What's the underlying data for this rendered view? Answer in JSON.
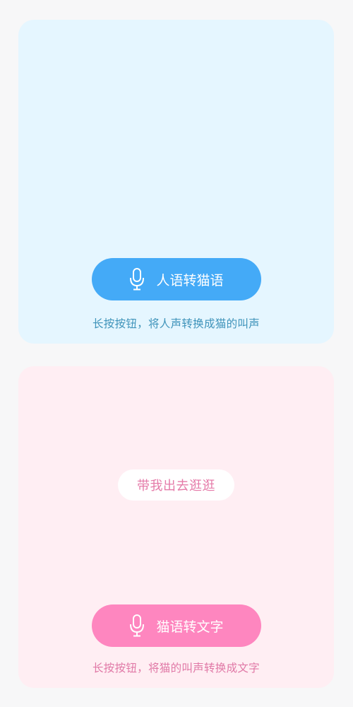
{
  "human_to_cat": {
    "button_label": "人语转猫语",
    "hint": "长按按钮，将人声转换成猫的叫声",
    "icon": "microphone-icon",
    "accent": "#44aaf7",
    "background": "#e5f6ff"
  },
  "cat_to_text": {
    "result_text": "带我出去逛逛",
    "button_label": "猫语转文字",
    "hint": "长按按钮，将猫的叫声转换成文字",
    "icon": "microphone-icon",
    "accent": "#fe86bf",
    "background": "#ffeef3"
  }
}
